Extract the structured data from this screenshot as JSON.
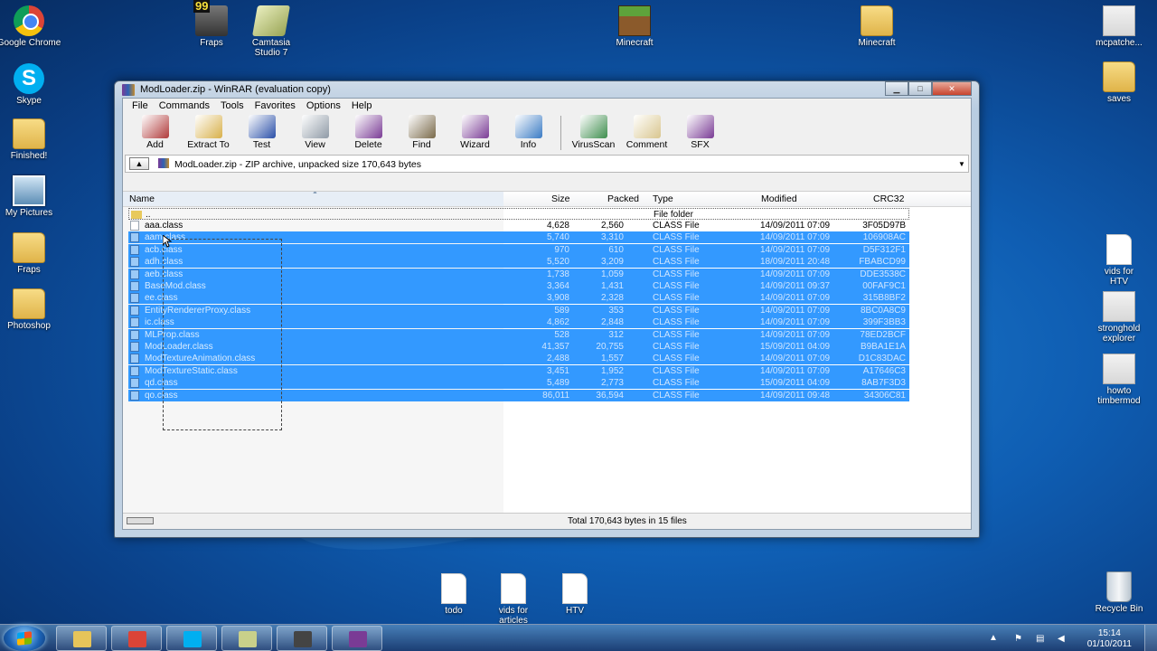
{
  "desktop": {
    "icons": [
      {
        "label": "Google Chrome",
        "icon": "chrome-icon"
      },
      {
        "label": "Fraps",
        "icon": "fraps-icon",
        "badge": "99"
      },
      {
        "label": "Camtasia Studio 7",
        "icon": "camtasia-icon"
      },
      {
        "label": "Minecraft",
        "icon": "minecraft-icon"
      },
      {
        "label": "Minecraft",
        "icon": "folder-icon"
      },
      {
        "label": "mcpatche...",
        "icon": "app-icon"
      },
      {
        "label": "Skype",
        "icon": "skype-icon"
      },
      {
        "label": "saves",
        "icon": "folder-icon"
      },
      {
        "label": "Finished!",
        "icon": "folder-icon"
      },
      {
        "label": "My Pictures",
        "icon": "folder-icon"
      },
      {
        "label": "vids for HTV",
        "icon": "file-icon"
      },
      {
        "label": "Fraps",
        "icon": "folder-icon"
      },
      {
        "label": "stronghold explorer",
        "icon": "video-icon"
      },
      {
        "label": "Photoshop",
        "icon": "folder-icon"
      },
      {
        "label": "howto timbermod",
        "icon": "video-icon"
      },
      {
        "label": "todo",
        "icon": "file-icon"
      },
      {
        "label": "vids for articles",
        "icon": "file-icon"
      },
      {
        "label": "HTV",
        "icon": "file-icon"
      },
      {
        "label": "Recycle Bin",
        "icon": "recycle-bin-icon"
      }
    ]
  },
  "window": {
    "title": "ModLoader.zip - WinRAR (evaluation copy)",
    "menu": [
      "File",
      "Commands",
      "Tools",
      "Favorites",
      "Options",
      "Help"
    ],
    "toolbar": [
      {
        "label": "Add",
        "icon": "add-icon",
        "color": "#b03a3a"
      },
      {
        "label": "Extract To",
        "icon": "extract-icon",
        "color": "#d8b04a"
      },
      {
        "label": "Test",
        "icon": "test-icon",
        "color": "#2a4fa8"
      },
      {
        "label": "View",
        "icon": "view-icon",
        "color": "#8f9aa6"
      },
      {
        "label": "Delete",
        "icon": "delete-icon",
        "color": "#7a3b95"
      },
      {
        "label": "Find",
        "icon": "find-icon",
        "color": "#7a6a4a"
      },
      {
        "label": "Wizard",
        "icon": "wizard-icon",
        "color": "#7a3b95"
      },
      {
        "label": "Info",
        "icon": "info-icon",
        "color": "#3a7bc4"
      },
      {
        "label": "VirusScan",
        "icon": "virusscan-icon",
        "color": "#3e8e4d"
      },
      {
        "label": "Comment",
        "icon": "comment-icon",
        "color": "#d9c68f"
      },
      {
        "label": "SFX",
        "icon": "sfx-icon",
        "color": "#7a3b95"
      }
    ],
    "address": "ModLoader.zip - ZIP archive, unpacked size 170,643 bytes",
    "columns": {
      "name": "Name",
      "size": "Size",
      "packed": "Packed",
      "type": "Type",
      "modified": "Modified",
      "crc": "CRC32"
    },
    "parent_row": {
      "name": "..",
      "type": "File folder"
    },
    "files": [
      {
        "name": "aaa.class",
        "size": "4,628",
        "packed": "2,560",
        "type": "CLASS File",
        "modified": "14/09/2011 07:09",
        "crc": "3F05D97B",
        "selected": false
      },
      {
        "name": "aam.class",
        "size": "5,740",
        "packed": "3,310",
        "type": "CLASS File",
        "modified": "14/09/2011 07:09",
        "crc": "106908AC",
        "selected": true
      },
      {
        "name": "acb.class",
        "size": "970",
        "packed": "610",
        "type": "CLASS File",
        "modified": "14/09/2011 07:09",
        "crc": "D5F312F1",
        "selected": true
      },
      {
        "name": "adh.class",
        "size": "5,520",
        "packed": "3,209",
        "type": "CLASS File",
        "modified": "18/09/2011 20:48",
        "crc": "FBABCD99",
        "selected": true
      },
      {
        "name": "aeb.class",
        "size": "1,738",
        "packed": "1,059",
        "type": "CLASS File",
        "modified": "14/09/2011 07:09",
        "crc": "DDE3538C",
        "selected": true
      },
      {
        "name": "BaseMod.class",
        "size": "3,364",
        "packed": "1,431",
        "type": "CLASS File",
        "modified": "14/09/2011 09:37",
        "crc": "00FAF9C1",
        "selected": true
      },
      {
        "name": "ee.class",
        "size": "3,908",
        "packed": "2,328",
        "type": "CLASS File",
        "modified": "14/09/2011 07:09",
        "crc": "315B8BF2",
        "selected": true
      },
      {
        "name": "EntityRendererProxy.class",
        "size": "589",
        "packed": "353",
        "type": "CLASS File",
        "modified": "14/09/2011 07:09",
        "crc": "8BC0A8C9",
        "selected": true
      },
      {
        "name": "ic.class",
        "size": "4,862",
        "packed": "2,848",
        "type": "CLASS File",
        "modified": "14/09/2011 07:09",
        "crc": "399F3BB3",
        "selected": true
      },
      {
        "name": "MLProp.class",
        "size": "528",
        "packed": "312",
        "type": "CLASS File",
        "modified": "14/09/2011 07:09",
        "crc": "78ED2BCF",
        "selected": true
      },
      {
        "name": "ModLoader.class",
        "size": "41,357",
        "packed": "20,755",
        "type": "CLASS File",
        "modified": "15/09/2011 04:09",
        "crc": "B9BA1E1A",
        "selected": true
      },
      {
        "name": "ModTextureAnimation.class",
        "size": "2,488",
        "packed": "1,557",
        "type": "CLASS File",
        "modified": "14/09/2011 07:09",
        "crc": "D1C83DAC",
        "selected": true
      },
      {
        "name": "ModTextureStatic.class",
        "size": "3,451",
        "packed": "1,952",
        "type": "CLASS File",
        "modified": "14/09/2011 07:09",
        "crc": "A17646C3",
        "selected": true
      },
      {
        "name": "qd.class",
        "size": "5,489",
        "packed": "2,773",
        "type": "CLASS File",
        "modified": "15/09/2011 04:09",
        "crc": "8AB7F3D3",
        "selected": true
      },
      {
        "name": "qo.class",
        "size": "86,011",
        "packed": "36,594",
        "type": "CLASS File",
        "modified": "14/09/2011 09:48",
        "crc": "34306C81",
        "selected": true
      }
    ],
    "status": "Total 170,643 bytes in 15 files"
  },
  "taskbar": {
    "buttons": [
      {
        "icon": "explorer-icon",
        "color": "#e6c45a"
      },
      {
        "icon": "chrome-icon",
        "color": "#db4437"
      },
      {
        "icon": "skype-icon",
        "color": "#00aff0"
      },
      {
        "icon": "camtasia-icon",
        "color": "#c9d08a"
      },
      {
        "icon": "fraps-icon",
        "color": "#444444"
      },
      {
        "icon": "winrar-icon",
        "color": "#7a3b95"
      }
    ],
    "time": "15:14",
    "date": "01/10/2011"
  },
  "colors": {
    "selection": "#3399ff"
  }
}
